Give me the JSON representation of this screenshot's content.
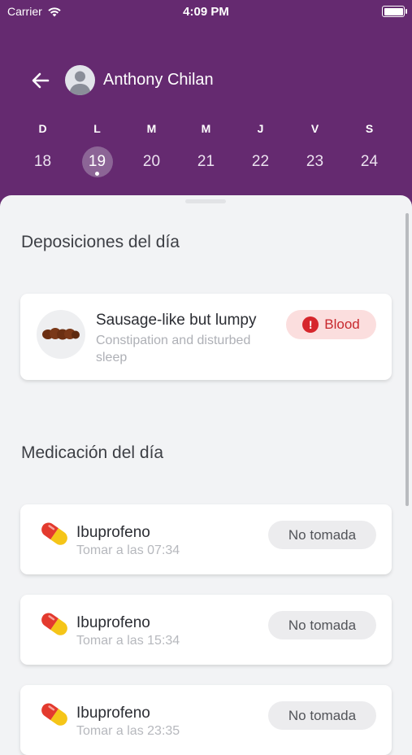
{
  "status_bar": {
    "carrier": "Carrier",
    "time": "4:09 PM"
  },
  "header": {
    "user_name": "Anthony Chilan"
  },
  "week": [
    {
      "letter": "D",
      "number": "18",
      "selected": false
    },
    {
      "letter": "L",
      "number": "19",
      "selected": true
    },
    {
      "letter": "M",
      "number": "20",
      "selected": false
    },
    {
      "letter": "M",
      "number": "21",
      "selected": false
    },
    {
      "letter": "J",
      "number": "22",
      "selected": false
    },
    {
      "letter": "V",
      "number": "23",
      "selected": false
    },
    {
      "letter": "S",
      "number": "24",
      "selected": false
    }
  ],
  "depositions": {
    "title": "Deposiciones del día",
    "entry": {
      "type": "Sausage-like but lumpy",
      "description": "Constipation and disturbed sleep",
      "badge": "Blood",
      "badge_icon": "!"
    }
  },
  "medication": {
    "title": "Medicación del día",
    "items": [
      {
        "name": "Ibuprofeno",
        "time": "Tomar a las 07:34",
        "status": "No tomada"
      },
      {
        "name": "Ibuprofeno",
        "time": "Tomar a las 15:34",
        "status": "No tomada"
      },
      {
        "name": "Ibuprofeno",
        "time": "Tomar a las 23:35",
        "status": "No tomada"
      }
    ]
  },
  "colors": {
    "header": "#652a70",
    "blood": "#d6262c",
    "pill_red": "#e33a2e",
    "pill_yellow": "#f5c518"
  },
  "icons": {
    "back": "arrow-left-icon",
    "avatar": "user-avatar-icon",
    "stool": "stool-type-icon",
    "pill": "pill-capsule-icon"
  }
}
